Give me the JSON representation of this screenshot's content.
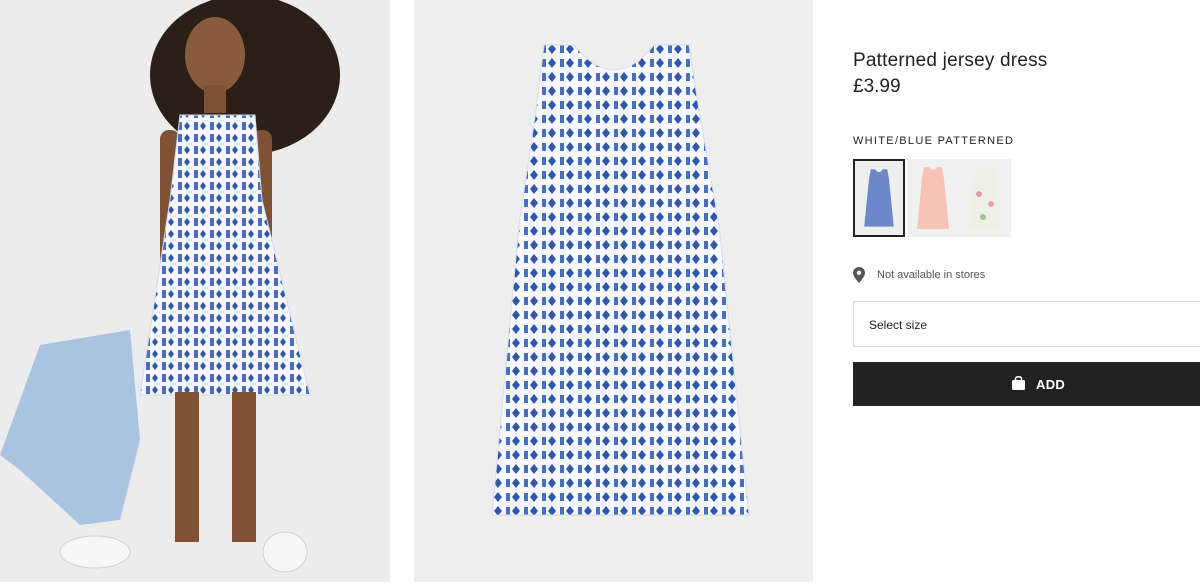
{
  "product": {
    "title": "Patterned jersey dress",
    "price": "£3.99"
  },
  "color_selector": {
    "selected_label": "WHITE/BLUE PATTERNED",
    "swatches": [
      {
        "name": "white-blue-patterned",
        "accent": "#3f66b8",
        "selected": true
      },
      {
        "name": "light-pink-patterned",
        "accent": "#f2b6a8",
        "selected": false
      },
      {
        "name": "white-floral",
        "accent": "#e8a3b6",
        "selected": false
      }
    ]
  },
  "availability": {
    "icon": "location-pin-icon",
    "text": "Not available in stores"
  },
  "size": {
    "placeholder": "Select size"
  },
  "add_button": {
    "icon": "shopping-bag-icon",
    "label": "ADD"
  },
  "colors": {
    "button_bg": "#222222",
    "pattern_blue": "#3f66b8",
    "image_bg": "#eeeeee"
  }
}
